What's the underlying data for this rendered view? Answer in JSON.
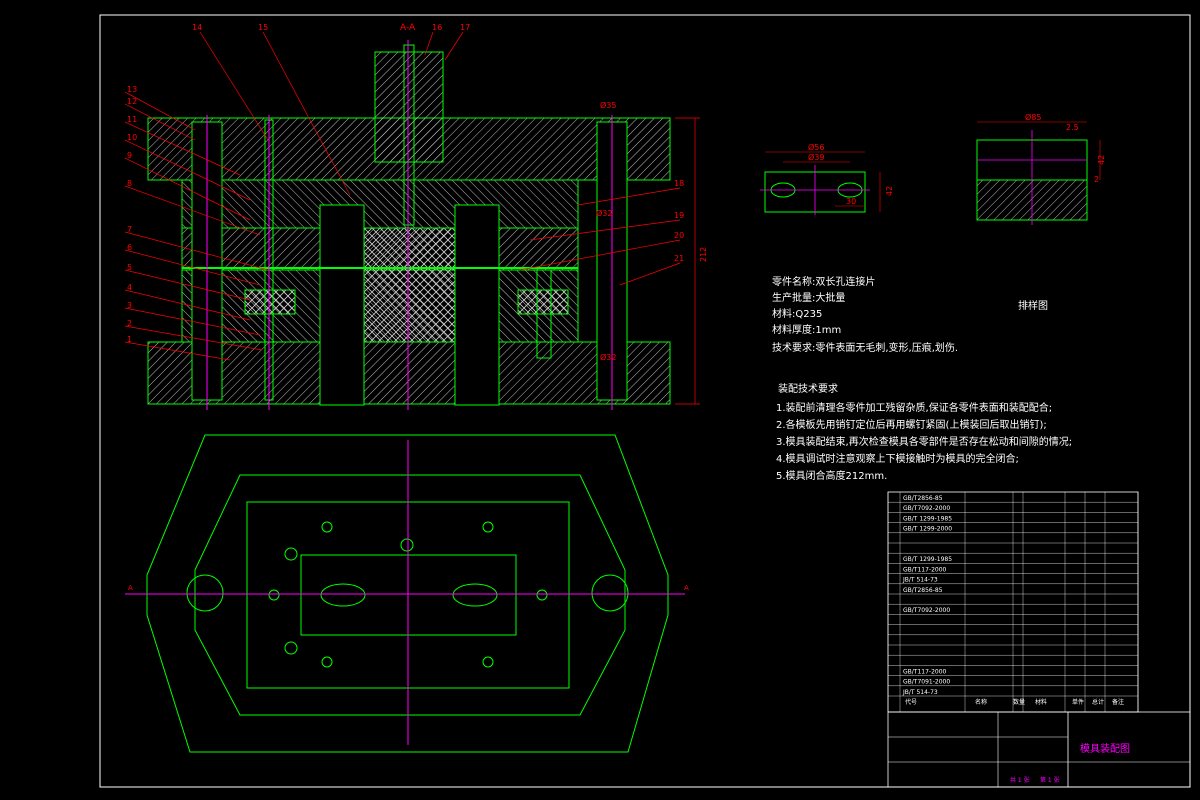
{
  "section_label": "A-A",
  "part_numbers_top": [
    "14",
    "15",
    "16",
    "17"
  ],
  "part_numbers_left": [
    "13",
    "12",
    "11",
    "10",
    "9",
    "8",
    "7",
    "6",
    "5",
    "4",
    "3",
    "2",
    "1"
  ],
  "part_numbers_right": [
    "18",
    "19",
    "20",
    "21"
  ],
  "dims": {
    "total_height": "212",
    "pin_dia": "Ø35",
    "guide_dia1": "Ø32",
    "guide_dia2": "Ø32",
    "strip_w1": "Ø56",
    "strip_w2": "Ø39",
    "strip_h": "42",
    "strip_pitch": "30",
    "layout_w": "Ø85",
    "layout_gap": "2.5",
    "layout_h1": "2",
    "layout_h2": "42"
  },
  "part_info": {
    "name": "零件名称:双长孔连接片",
    "batch": "生产批量:大批量",
    "material": "材料:Q235",
    "thickness": "材料厚度:1mm",
    "tech_req": "技术要求:零件表面无毛刺,变形,压痕,划伤."
  },
  "layout_title": "排样图",
  "assembly_requirements": {
    "title": "装配技术要求",
    "items": [
      "1.装配前清理各零件加工残留杂质,保证各零件表面和装配配合;",
      "2.各模板先用销钉定位后再用螺钉紧固(上模装回后取出销钉);",
      "3.模具装配结束,再次检查模具各零部件是否存在松动和间隙的情况;",
      "4.模具调试时注意观察上下模接触时为模具的完全闭合;",
      "5.模具闭合高度212mm."
    ]
  },
  "bom_rows": [
    "GB/T2856-85",
    "GB/T7092-2000",
    "GB/T 1299-1985",
    "GB/T 1299-2000",
    "",
    "",
    "GB/T 1299-1985",
    "GB/T117-2000",
    "JB/T 514-73",
    "GB/T2856-85",
    "",
    "GB/T7092-2000",
    "",
    "",
    "",
    "",
    "",
    "GB/T117-2000",
    "GB/T7091-2000",
    "JB/T 514-73"
  ],
  "bom_header": [
    "代号",
    "名称",
    "数量",
    "材料",
    "单件",
    "总计",
    "备注"
  ],
  "title_block": {
    "drawing_title": "模具装配图",
    "sheet": "共 1 张",
    "sheet_of": "第 1 张"
  },
  "colors": {
    "line": "#00ff00",
    "center": "#ff00ff",
    "leader": "#ff0000",
    "text": "#ffffff",
    "bg": "#000000",
    "hatch": "#dddddd",
    "title": "#ff00ff"
  }
}
